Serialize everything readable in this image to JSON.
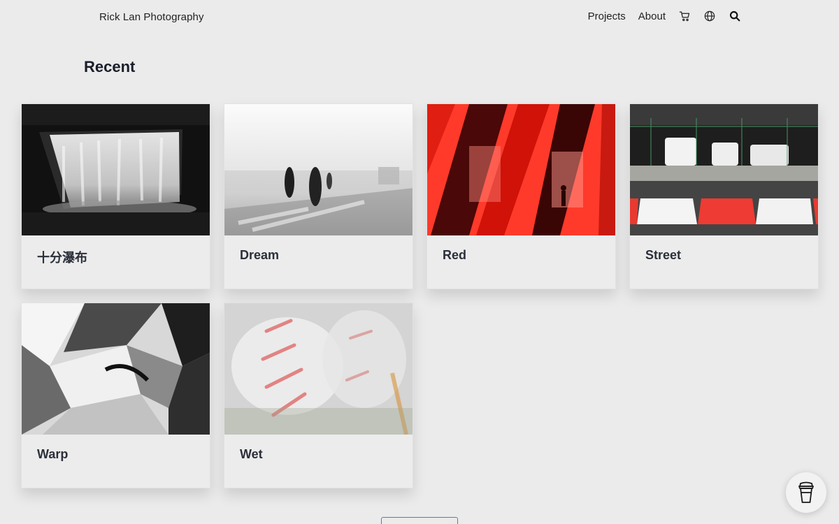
{
  "header": {
    "brand": "Rick Lan Photography",
    "nav": [
      "Projects",
      "About"
    ],
    "icons": [
      "cart-icon",
      "globe-icon",
      "search-icon"
    ]
  },
  "section": {
    "title": "Recent"
  },
  "projects": [
    {
      "title": "十分瀑布",
      "image": "waterfall-bw"
    },
    {
      "title": "Dream",
      "image": "figures-blurred-bw"
    },
    {
      "title": "Red",
      "image": "red-reflections"
    },
    {
      "title": "Street",
      "image": "parking-barriers"
    },
    {
      "title": "Warp",
      "image": "warped-abstract-bw"
    },
    {
      "title": "Wet",
      "image": "wet-glass-blur"
    }
  ],
  "colors": {
    "background": "#ebebeb",
    "card": "#ececec",
    "text": "#1a1e2c",
    "button_border": "#4a7bd0"
  }
}
